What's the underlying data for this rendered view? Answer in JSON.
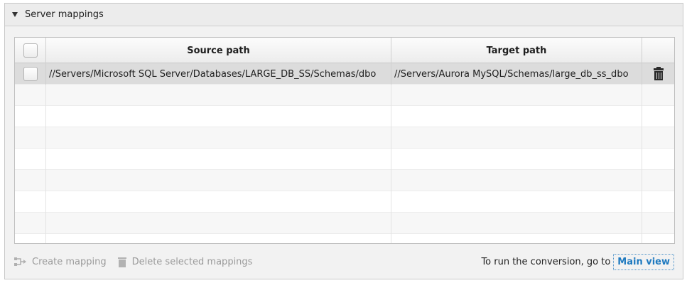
{
  "panel": {
    "title": "Server mappings"
  },
  "table": {
    "columns": {
      "source": "Source path",
      "target": "Target path"
    },
    "rows": [
      {
        "source": "//Servers/Microsoft SQL Server/Databases/LARGE_DB_SS/Schemas/dbo",
        "target": "//Servers/Aurora MySQL/Schemas/large_db_ss_dbo",
        "selected": true
      }
    ]
  },
  "footer": {
    "create_mapping": "Create mapping",
    "delete_selected": "Delete selected mappings",
    "hint": "To run the conversion, go to",
    "main_view": "Main view"
  },
  "icons": {
    "collapse": "triangle-down-icon",
    "row_delete": "trash-icon",
    "create_mapping": "mapping-icon",
    "delete_selected": "trash-icon"
  },
  "colors": {
    "link": "#1f7ac0",
    "selected_row": "#dcdcdc",
    "disabled_text": "#9a9a9a"
  }
}
